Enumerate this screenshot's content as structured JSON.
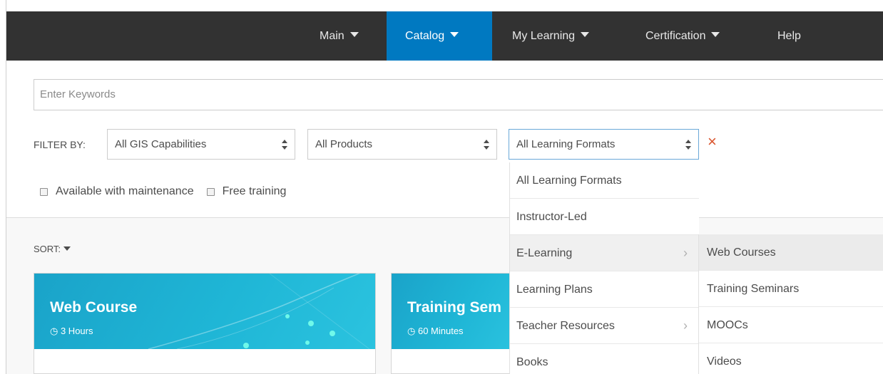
{
  "nav": {
    "items": [
      {
        "label": "Main",
        "caret": true
      },
      {
        "label": "Catalog",
        "caret": true,
        "active": true
      },
      {
        "label": "My Learning",
        "caret": true
      },
      {
        "label": "Certification",
        "caret": true
      },
      {
        "label": "Help",
        "caret": false
      }
    ]
  },
  "search": {
    "placeholder": "Enter Keywords"
  },
  "filters": {
    "label": "FILTER BY:",
    "capabilities": "All GIS Capabilities",
    "products": "All Products",
    "formats": "All Learning Formats",
    "clear_icon": "×"
  },
  "checkboxes": {
    "maintenance": "Available with maintenance",
    "free": "Free training"
  },
  "sort": {
    "label": "SORT:"
  },
  "cards": [
    {
      "title": "Web Course",
      "duration": "3 Hours"
    },
    {
      "title": "Training Sem",
      "duration": "60 Minutes"
    }
  ],
  "icons": {
    "clock": "◷"
  },
  "dropdown": {
    "items": [
      "All Learning Formats",
      "Instructor-Led",
      "E-Learning",
      "Learning Plans",
      "Teacher Resources",
      "Books"
    ],
    "chevron": "›"
  },
  "submenu": {
    "items": [
      "Web Courses",
      "Training Seminars",
      "MOOCs",
      "Videos"
    ]
  },
  "colors": {
    "navbar": "#323232",
    "nav_active": "#0079c1",
    "card_accent": "#1fb6d6",
    "clear_x": "#d9532c"
  }
}
